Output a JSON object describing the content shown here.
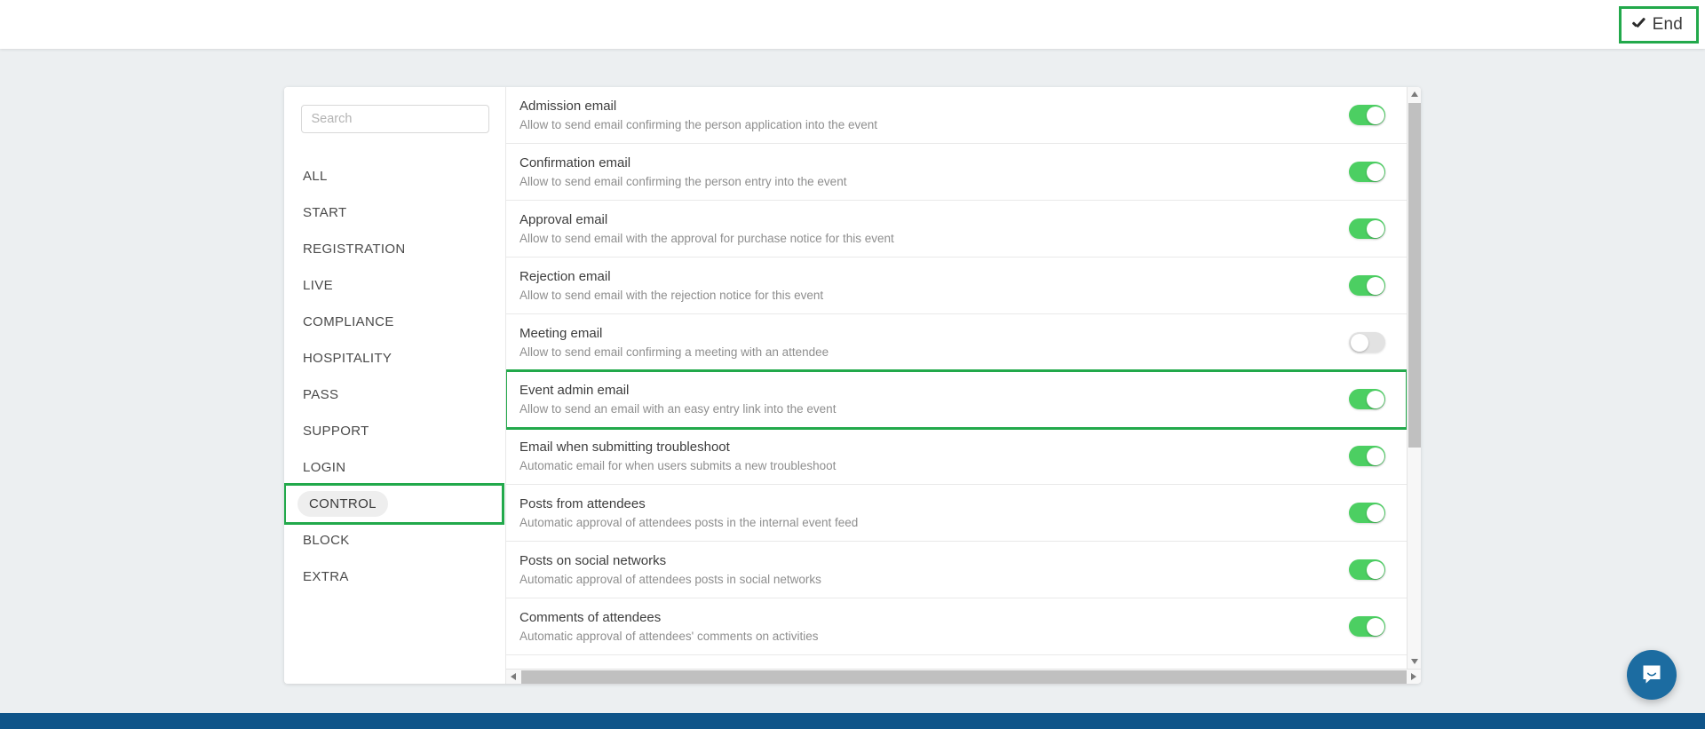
{
  "header": {
    "end_button_label": "End",
    "end_button_icon": "check-icon",
    "highlight_color": "#22a94b"
  },
  "sidebar": {
    "search": {
      "placeholder": "Search",
      "value": ""
    },
    "items": [
      {
        "label": "ALL",
        "selected": false,
        "highlighted": false
      },
      {
        "label": "START",
        "selected": false,
        "highlighted": false
      },
      {
        "label": "REGISTRATION",
        "selected": false,
        "highlighted": false
      },
      {
        "label": "LIVE",
        "selected": false,
        "highlighted": false
      },
      {
        "label": "COMPLIANCE",
        "selected": false,
        "highlighted": false
      },
      {
        "label": "HOSPITALITY",
        "selected": false,
        "highlighted": false
      },
      {
        "label": "PASS",
        "selected": false,
        "highlighted": false
      },
      {
        "label": "SUPPORT",
        "selected": false,
        "highlighted": false
      },
      {
        "label": "LOGIN",
        "selected": false,
        "highlighted": false
      },
      {
        "label": "CONTROL",
        "selected": true,
        "highlighted": true
      },
      {
        "label": "BLOCK",
        "selected": false,
        "highlighted": false
      },
      {
        "label": "EXTRA",
        "selected": false,
        "highlighted": false
      }
    ]
  },
  "options": [
    {
      "title": "Admission email",
      "description": "Allow to send email confirming the person application into the event",
      "toggle": "on",
      "highlighted": false
    },
    {
      "title": "Confirmation email",
      "description": "Allow to send email confirming the person entry into the event",
      "toggle": "on",
      "highlighted": false
    },
    {
      "title": "Approval email",
      "description": "Allow to send email with the approval for purchase notice for this event",
      "toggle": "on",
      "highlighted": false
    },
    {
      "title": "Rejection email",
      "description": "Allow to send email with the rejection notice for this event",
      "toggle": "on",
      "highlighted": false
    },
    {
      "title": "Meeting email",
      "description": "Allow to send email confirming a meeting with an attendee",
      "toggle": "off",
      "highlighted": false
    },
    {
      "title": "Event admin email",
      "description": "Allow to send an email with an easy entry link into the event",
      "toggle": "on",
      "highlighted": true
    },
    {
      "title": "Email when submitting troubleshoot",
      "description": "Automatic email for when users submits a new troubleshoot",
      "toggle": "on",
      "highlighted": false
    },
    {
      "title": "Posts from attendees",
      "description": "Automatic approval of attendees posts in the internal event feed",
      "toggle": "on",
      "highlighted": false
    },
    {
      "title": "Posts on social networks",
      "description": "Automatic approval of attendees posts in social networks",
      "toggle": "on",
      "highlighted": false
    },
    {
      "title": "Comments of attendees",
      "description": "Automatic approval of attendees' comments on activities",
      "toggle": "on",
      "highlighted": false
    }
  ],
  "scrollbars": {
    "vertical": {
      "up_icon": "chevron-up-icon",
      "down_icon": "chevron-down-icon"
    },
    "horizontal": {
      "left_icon": "chevron-left-icon",
      "right_icon": "chevron-right-icon"
    }
  },
  "chat_launcher": {
    "icon": "chat-bubble-icon",
    "color": "#1c6ca1"
  },
  "colors": {
    "toggle_on": "#4ccf62",
    "toggle_off": "#e2e2e2",
    "highlight": "#22a94b",
    "bottom_bar": "#0f5489",
    "page_background": "#eceff1"
  }
}
